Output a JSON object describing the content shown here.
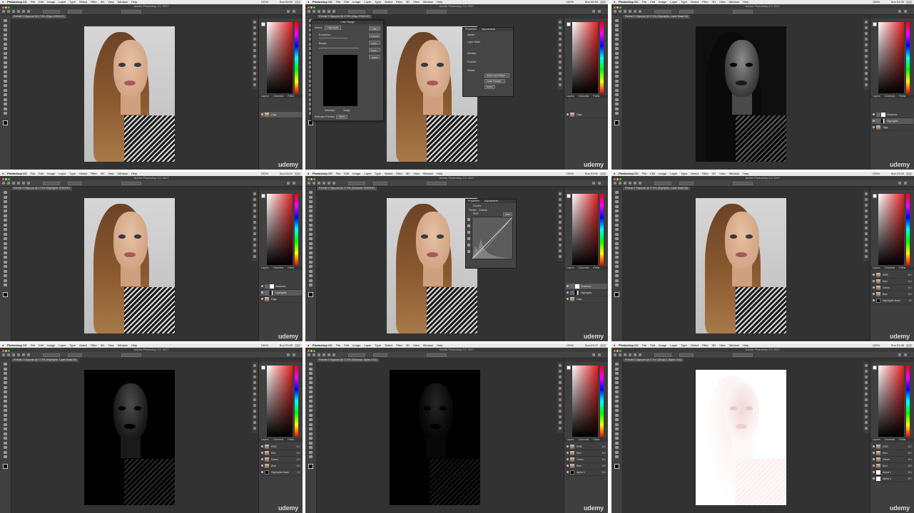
{
  "app": {
    "apple_menu": "",
    "menu": [
      "Photoshop CC",
      "File",
      "Edit",
      "Image",
      "Layer",
      "Type",
      "Select",
      "Filter",
      "3D",
      "View",
      "Window",
      "Help"
    ],
    "window_title": "Adobe Photoshop CC 2017",
    "zoom_status": "100%",
    "watermark": "udemy"
  },
  "cells": [
    {
      "clock": "Sun 00:59",
      "doc_tab": "Portrait 2 Olga.psd @ 17.5% (Olga, RGB/16*)",
      "canvas": "photo",
      "panel_tabs": [
        "Layers",
        "Channels",
        "Paths"
      ],
      "layers": [
        {
          "name": "Olga",
          "thumb": "photo",
          "selected": true
        }
      ]
    },
    {
      "clock": "Sun 00:59",
      "doc_tab": "Portrait 2 Olga.psd @ 17.5% (Olga, RGB/16*)",
      "canvas": "photo",
      "dialog": {
        "title": "Color Range",
        "select_label": "Select:",
        "select_value": "Highlights",
        "fuzziness_label": "Fuzziness:",
        "range_label": "Range:",
        "buttons": [
          "OK",
          "Cancel",
          "Load...",
          "Save...",
          "Invert"
        ],
        "radio_selection": "Selection",
        "radio_image": "Image",
        "preview_label": "Selection Preview:",
        "preview_value": "None"
      },
      "properties": {
        "tabs": [
          "Properties",
          "Adjustments"
        ],
        "mode": "Masks",
        "layer_mask": "Layer Mask",
        "density": "Density:",
        "feather": "Feather:",
        "refine": "Refine:",
        "select_and_mask": "Select and Mask...",
        "color_range": "Color Range...",
        "invert": "Invert"
      },
      "panel_tabs": [
        "Layers",
        "Channels",
        "Paths"
      ],
      "layers": [
        {
          "name": "Olga",
          "thumb": "photo",
          "selected": false
        }
      ]
    },
    {
      "clock": "Sun 01:00",
      "doc_tab": "Portrait 2 Olga.psd @ 17.5% (Highlights, Layer Mask/16)",
      "canvas": "dark",
      "panel_tabs": [
        "Layers",
        "Channels",
        "Paths"
      ],
      "layers": [
        {
          "name": "Shadows",
          "thumb": "white",
          "selected": false
        },
        {
          "name": "Highlights",
          "thumb": "mask",
          "selected": true
        },
        {
          "name": "Olga",
          "thumb": "photo",
          "selected": false
        }
      ]
    },
    {
      "clock": "Sun 01:01",
      "doc_tab": "Portrait 2 Olga.psd @ 17.5% (Highlights, RGB/16*)",
      "canvas": "photo",
      "panel_tabs": [
        "Layers",
        "Channels",
        "Paths"
      ],
      "layers": [
        {
          "name": "Shadows",
          "thumb": "white",
          "selected": false
        },
        {
          "name": "Highlights",
          "thumb": "mask",
          "selected": true
        },
        {
          "name": "Olga",
          "thumb": "photo",
          "selected": false
        }
      ]
    },
    {
      "clock": "Sun 01:01",
      "doc_tab": "Portrait 2 Olga.psd @ 17.5% (Shadows, RGB/16*)",
      "canvas": "photo",
      "curves": {
        "tabs": [
          "Properties",
          "Adjustments"
        ],
        "title": "Curves",
        "preset_label": "Preset:",
        "preset_value": "Custom",
        "channel_value": "RGB",
        "auto": "Auto"
      },
      "panel_tabs": [
        "Layers",
        "Channels",
        "Paths"
      ],
      "layers": [
        {
          "name": "Shadows",
          "thumb": "white",
          "selected": true
        },
        {
          "name": "Highlights",
          "thumb": "mask",
          "selected": false
        },
        {
          "name": "Olga",
          "thumb": "photo",
          "selected": false
        }
      ]
    },
    {
      "clock": "Sun 01:02",
      "doc_tab": "Portrait 2 Olga.psd @ 17.5% (Highlights, Layer Mask/16)",
      "canvas": "photo",
      "panel_tabs": [
        "Layers",
        "Channels",
        "Paths"
      ],
      "channels": [
        {
          "name": "RGB",
          "key": "⌘2",
          "thumb": "photo"
        },
        {
          "name": "Red",
          "key": "⌘3",
          "thumb": "photo"
        },
        {
          "name": "Green",
          "key": "⌘4",
          "thumb": "photo"
        },
        {
          "name": "Blue",
          "key": "⌘5",
          "thumb": "photo"
        },
        {
          "name": "Highlights Mask",
          "key": "⌘\\",
          "thumb": "black"
        }
      ]
    },
    {
      "clock": "Sun 01:05",
      "doc_tab": "Portrait 2 Olga.psd @ 17.5% (Highlights, Layer Mask/16)",
      "canvas": "vdark",
      "panel_tabs": [
        "Layers",
        "Channels",
        "Paths"
      ],
      "channels": [
        {
          "name": "RGB",
          "key": "⌘2",
          "thumb": "photo"
        },
        {
          "name": "Red",
          "key": "⌘3",
          "thumb": "photo"
        },
        {
          "name": "Green",
          "key": "⌘4",
          "thumb": "photo"
        },
        {
          "name": "Blue",
          "key": "⌘5",
          "thumb": "photo"
        },
        {
          "name": "Highlights Mask",
          "key": "⌘\\",
          "thumb": "black"
        }
      ]
    },
    {
      "clock": "Sun 01:07",
      "doc_tab": "Portrait 2 Olga.psd @ 17.5% (Shadows, Alpha 1/16)",
      "canvas": "xdark",
      "panel_tabs": [
        "Layers",
        "Channels",
        "Paths"
      ],
      "channels": [
        {
          "name": "RGB",
          "key": "⌘2",
          "thumb": "photo"
        },
        {
          "name": "Red",
          "key": "⌘3",
          "thumb": "photo"
        },
        {
          "name": "Green",
          "key": "⌘4",
          "thumb": "photo"
        },
        {
          "name": "Blue",
          "key": "⌘5",
          "thumb": "photo"
        },
        {
          "name": "Alpha 1",
          "key": "⌘6",
          "thumb": "black"
        }
      ]
    },
    {
      "clock": "Sun 01:09",
      "doc_tab": "Portrait 2 Olga.psd @ 17.5% (Group 1, Alpha 1/16)",
      "canvas": "white",
      "panel_tabs": [
        "Layers",
        "Channels",
        "Paths"
      ],
      "channels": [
        {
          "name": "RGB",
          "key": "⌘2",
          "thumb": "photo"
        },
        {
          "name": "Red",
          "key": "⌘3",
          "thumb": "photo"
        },
        {
          "name": "Green",
          "key": "⌘4",
          "thumb": "photo"
        },
        {
          "name": "Blue",
          "key": "⌘5",
          "thumb": "photo"
        },
        {
          "name": "Alpha 1",
          "key": "⌘6",
          "thumb": "white"
        },
        {
          "name": "Alpha 2",
          "key": "⌘7",
          "thumb": "white"
        }
      ]
    }
  ]
}
